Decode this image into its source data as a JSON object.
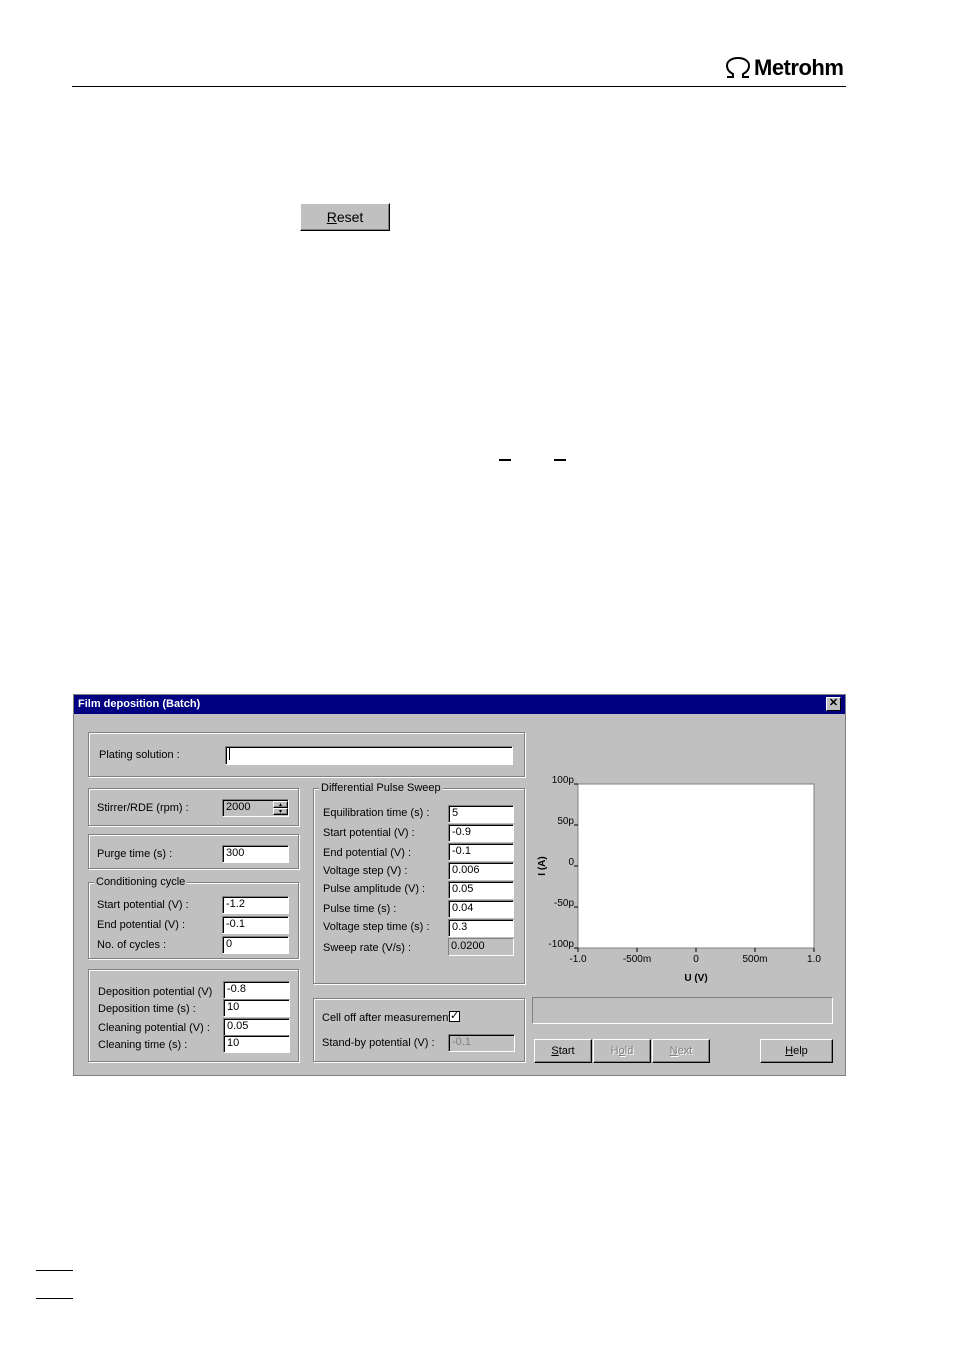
{
  "header": {
    "logo_text": "Metrohm"
  },
  "reset_button": {
    "label_u": "R",
    "label_rest": "eset"
  },
  "dialog": {
    "title": "Film deposition (Batch)",
    "close": "✕",
    "plating": {
      "label": "Plating solution :",
      "value": ""
    },
    "stirrer": {
      "label": "Stirrer/RDE (rpm) :",
      "value": "2000"
    },
    "purge": {
      "label": "Purge time (s) :",
      "value": "300"
    },
    "conditioning": {
      "title": "Conditioning cycle",
      "start_label": "Start potential (V) :",
      "start_value": "-1.2",
      "end_label": "End potential (V) :",
      "end_value": "-0.1",
      "cycles_label": "No. of cycles :",
      "cycles_value": "0"
    },
    "deposition": {
      "dep_pot_label": "Deposition potential (V)",
      "dep_pot_value": "-0.8",
      "dep_time_label": "Deposition time (s) :",
      "dep_time_value": "10",
      "clean_pot_label": "Cleaning potential (V) :",
      "clean_pot_value": "0.05",
      "clean_time_label": "Cleaning time (s) :",
      "clean_time_value": "10"
    },
    "dps": {
      "title": "Differential Pulse Sweep",
      "equil_label": "Equilibration time (s) :",
      "equil_value": "5",
      "start_label": "Start potential (V) :",
      "start_value": "-0.9",
      "end_label": "End potential (V) :",
      "end_value": "-0.1",
      "vstep_label": "Voltage step (V) :",
      "vstep_value": "0.006",
      "pamp_label": "Pulse amplitude (V) :",
      "pamp_value": "0.05",
      "ptime_label": "Pulse time (s) :",
      "ptime_value": "0.04",
      "vstime_label": "Voltage step time (s) :",
      "vstime_value": "0.3",
      "sweep_label": "Sweep rate (V/s) :",
      "sweep_value": "0.0200"
    },
    "celloff": {
      "label": "Cell off after measurement :",
      "checked": "✓"
    },
    "standby": {
      "label": "Stand-by potential (V) :",
      "value": "-0.1"
    },
    "buttons": {
      "start_u": "S",
      "start_rest": "tart",
      "hold_pre": "H",
      "hold_u": "o",
      "hold_rest": "ld",
      "next_u": "N",
      "next_rest": "ext",
      "help_u": "H",
      "help_rest": "elp"
    },
    "plot": {
      "ylabel": "I (A)",
      "xlabel": "U (V)",
      "y_ticks": [
        "100p",
        "50p",
        "0",
        "-50p",
        "-100p"
      ],
      "x_ticks": [
        "-1.0",
        "-500m",
        "0",
        "500m",
        "1.0"
      ]
    }
  },
  "chart_data": {
    "type": "line",
    "xlabel": "U (V)",
    "ylabel": "I (A)",
    "xlim": [
      -1.0,
      1.0
    ],
    "ylim": [
      -1e-10,
      1e-10
    ],
    "x_tick_labels": [
      "-1.0",
      "-500m",
      "0",
      "500m",
      "1.0"
    ],
    "y_tick_labels": [
      "100p",
      "50p",
      "0",
      "-50p",
      "-100p"
    ],
    "series": []
  }
}
